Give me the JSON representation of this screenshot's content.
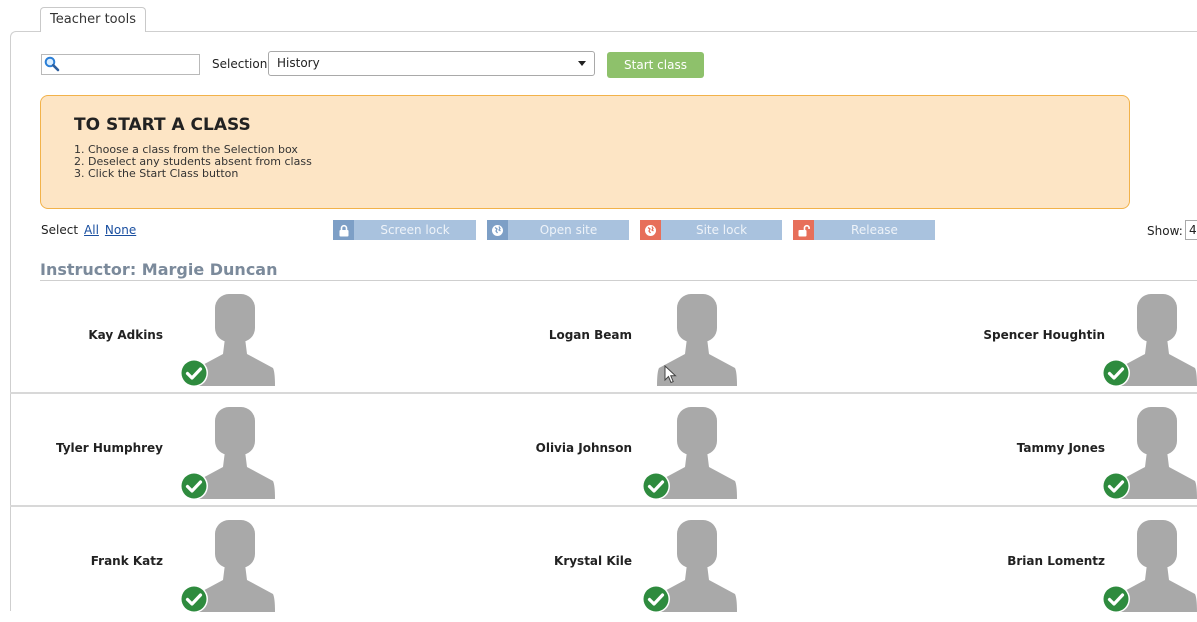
{
  "tab": {
    "label": "Teacher tools"
  },
  "toolbar": {
    "search_value": "",
    "selection_label": "Selection",
    "selection_value": "History",
    "start_label": "Start class"
  },
  "info": {
    "title": "TO START A CLASS",
    "steps": [
      "1. Choose a class from the Selection box",
      "2. Deselect any students absent from class",
      "3. Click the Start Class button"
    ]
  },
  "select_row": {
    "label": "Select",
    "all": "All",
    "none": "None"
  },
  "actions": {
    "screen_lock": "Screen lock",
    "open_site": "Open site",
    "site_lock": "Site lock",
    "release": "Release"
  },
  "show": {
    "label": "Show:",
    "value": "4"
  },
  "instructor": "Instructor: Margie Duncan",
  "students": [
    [
      "Kay Adkins",
      "Logan Beam",
      "Spencer Houghtin"
    ],
    [
      "Tyler Humphrey",
      "Olivia Johnson",
      "Tammy Jones"
    ],
    [
      "Frank Katz",
      "Krystal Kile",
      "Brian Lomentz"
    ]
  ],
  "checked": [
    [
      true,
      false,
      true
    ],
    [
      true,
      true,
      true
    ],
    [
      true,
      true,
      true
    ]
  ],
  "colors": {
    "accent_green": "#8ec16b",
    "check_green": "#2e8b3e",
    "info_bg": "#fde5c5",
    "info_border": "#f2b24a",
    "action_disabled": "#a9c2de",
    "site_lock_icon": "#e76f5a"
  }
}
